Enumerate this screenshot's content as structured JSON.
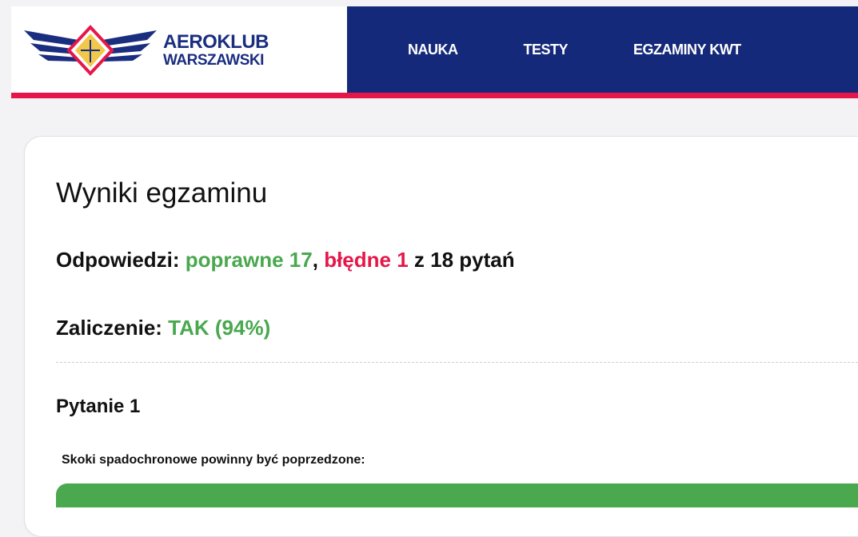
{
  "brand": {
    "line1": "AEROKLUB",
    "line2": "WARSZAWSKI",
    "colors": {
      "navy": "#14297a",
      "red": "#e5174a",
      "green": "#4aa84f"
    }
  },
  "nav": {
    "items": [
      "NAUKA",
      "TESTY",
      "EGZAMINY KWT"
    ]
  },
  "results": {
    "title": "Wyniki egzaminu",
    "answers_label": "Odpowiedzi:",
    "correct_text": "poprawne 17",
    "separator": ",",
    "wrong_text": "błędne 1",
    "total_text": "z 18 pytań",
    "pass_label": "Zaliczenie:",
    "pass_value": "TAK (94%)"
  },
  "question": {
    "title": "Pytanie 1",
    "text": "Skoki spadochronowe powinny być poprzedzone:"
  }
}
